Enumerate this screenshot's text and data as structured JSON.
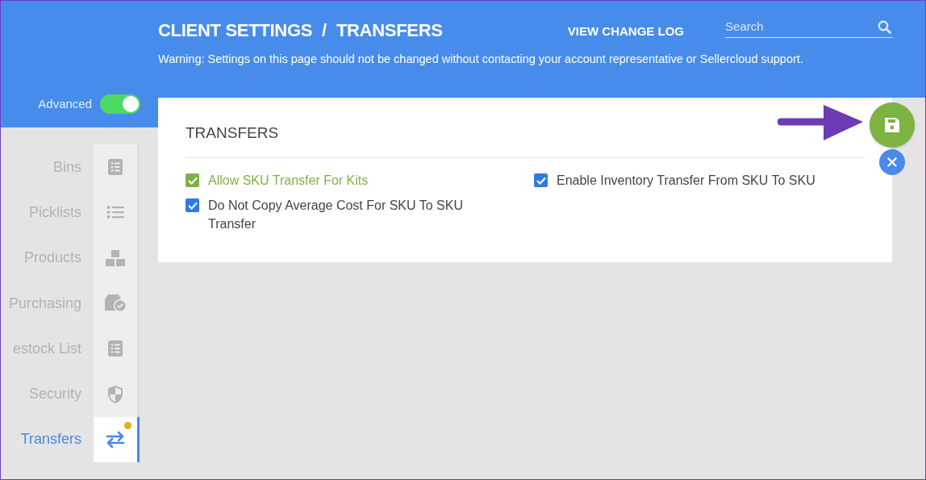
{
  "header": {
    "breadcrumb": [
      "CLIENT SETTINGS",
      "TRANSFERS"
    ],
    "separator": "/",
    "change_log_link": "VIEW CHANGE LOG",
    "search": {
      "placeholder": "Search"
    },
    "warning": "Warning: Settings on this page should not be changed without contacting your account representative or Sellercloud support."
  },
  "advanced_toggle": {
    "label": "Advanced",
    "on": true
  },
  "sidebar": {
    "items": [
      {
        "label": "Bins",
        "kind": "list-box",
        "selected": false,
        "unsaved": false
      },
      {
        "label": "Picklists",
        "kind": "list",
        "selected": false,
        "unsaved": false
      },
      {
        "label": "Products",
        "kind": "boxes",
        "selected": false,
        "unsaved": false
      },
      {
        "label": "Purchasing",
        "kind": "box-check",
        "selected": false,
        "unsaved": false
      },
      {
        "label": "estock List",
        "kind": "list-box",
        "selected": false,
        "unsaved": false
      },
      {
        "label": "Security",
        "kind": "shield",
        "selected": false,
        "unsaved": false
      },
      {
        "label": "Transfers",
        "kind": "arrows",
        "selected": true,
        "unsaved": true
      }
    ]
  },
  "card": {
    "title": "TRANSFERS",
    "settings": [
      {
        "label": "Allow SKU Transfer For Kits",
        "checked": true,
        "modified": true
      },
      {
        "label": "Enable Inventory Transfer From SKU To SKU",
        "checked": true,
        "modified": false
      },
      {
        "label": "Do Not Copy Average Cost For SKU To SKU Transfer",
        "checked": true,
        "modified": false
      }
    ]
  }
}
